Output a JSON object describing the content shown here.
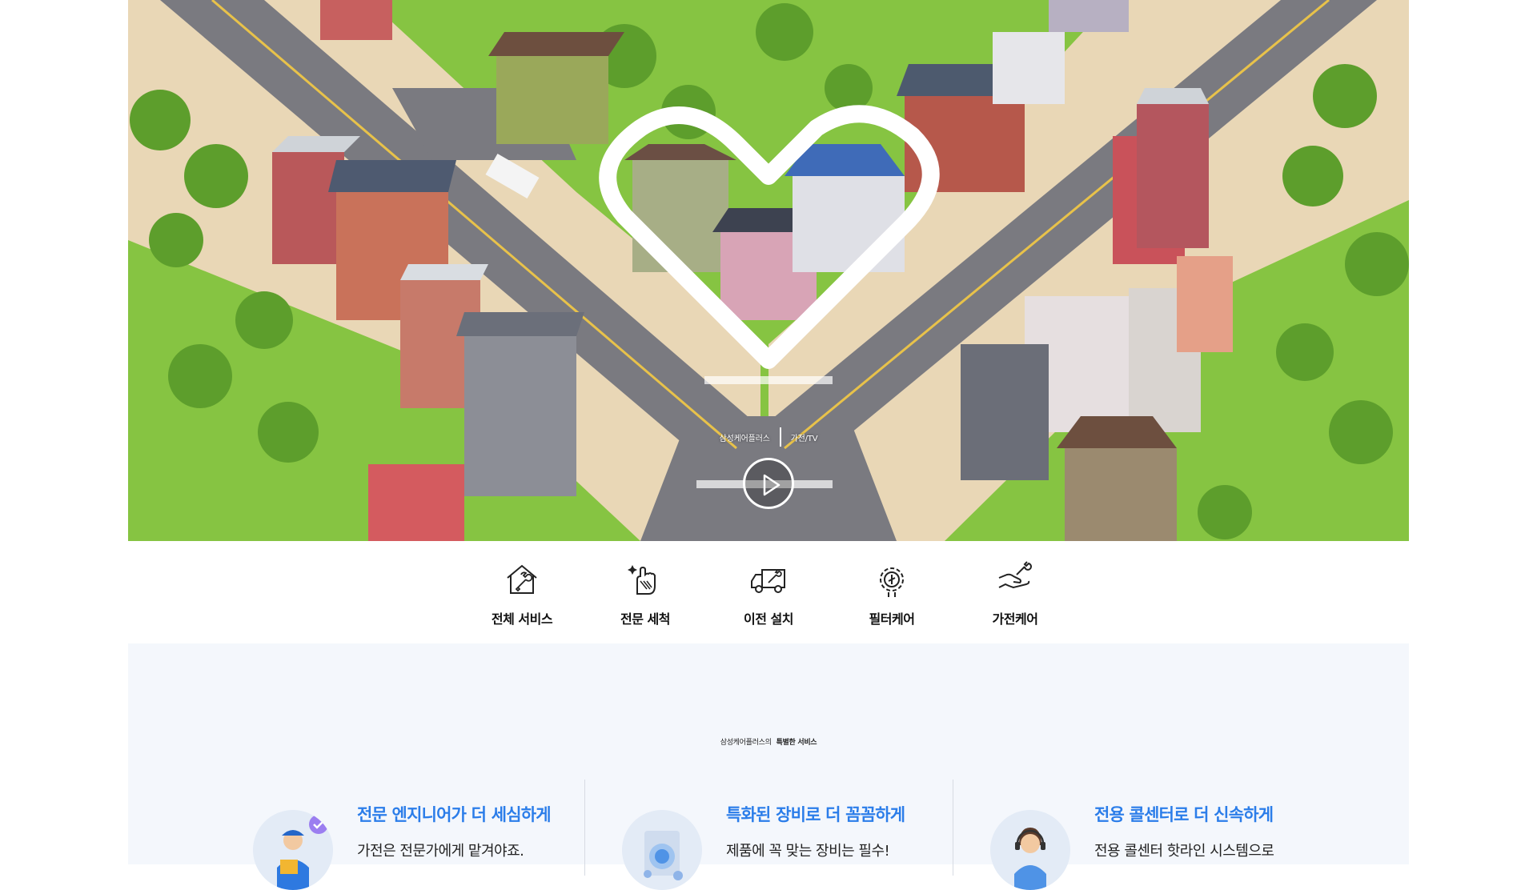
{
  "hero": {
    "brand_label": "삼성케어플러스",
    "category_label": "가전/TV",
    "play_icon": "play-icon"
  },
  "service_nav": [
    {
      "label": "전체 서비스",
      "icon": "house-wrench-icon"
    },
    {
      "label": "전문 세척",
      "icon": "cleaning-hand-icon"
    },
    {
      "label": "이전 설치",
      "icon": "moving-truck-icon"
    },
    {
      "label": "필터케어",
      "icon": "filter-gear-icon"
    },
    {
      "label": "가전케어",
      "icon": "hand-wrench-icon"
    }
  ],
  "features": {
    "kicker_prefix": "삼성케어플러스의",
    "kicker_highlight": "특별한 서비스",
    "items": [
      {
        "title": "전문 엔지니어가 더 세심하게",
        "desc": "가전은 전문가에게 맡겨야죠.",
        "icon": "engineer-avatar"
      },
      {
        "title": "특화된 장비로 더 꼼꼼하게",
        "desc": "제품에 꼭 맞는 장비는 필수!",
        "icon": "washing-machine-avatar"
      },
      {
        "title": "전용 콜센터로 더 신속하게",
        "desc": "전용 콜센터 핫라인 시스템으로",
        "icon": "call-center-avatar"
      }
    ]
  },
  "colors": {
    "accent": "#2b7de9",
    "section_bg": "#f4f7fc"
  }
}
